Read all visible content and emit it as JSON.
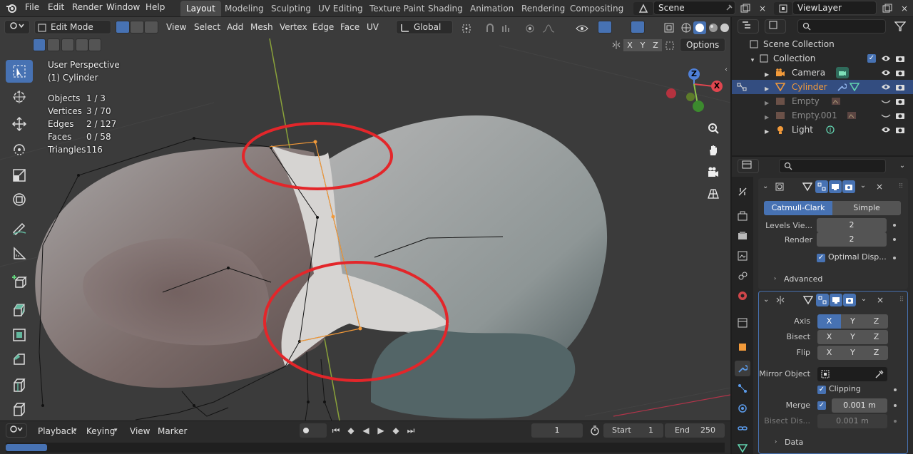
{
  "topbar": {
    "menus": [
      "File",
      "Edit",
      "Render",
      "Window",
      "Help"
    ],
    "workspaces": [
      "Layout",
      "Modeling",
      "Sculpting",
      "UV Editing",
      "Texture Paint",
      "Shading",
      "Animation",
      "Rendering",
      "Compositing"
    ],
    "active_workspace": "Layout",
    "scene": "Scene",
    "view_layer": "ViewLayer"
  },
  "viewport_header": {
    "mode": "Edit Mode",
    "menus": [
      "View",
      "Select",
      "Add",
      "Mesh",
      "Vertex",
      "Edge",
      "Face",
      "UV"
    ],
    "transform_orientation": "Global",
    "options_label": "Options",
    "axis_toggles": [
      "X",
      "Y",
      "Z"
    ]
  },
  "overlay": {
    "view_name": "User Perspective",
    "object_name": "(1) Cylinder",
    "stats": [
      {
        "label": "Objects",
        "value": "1 / 3"
      },
      {
        "label": "Vertices",
        "value": "3 / 70"
      },
      {
        "label": "Edges",
        "value": "2 / 127"
      },
      {
        "label": "Faces",
        "value": "0 / 58"
      },
      {
        "label": "Triangles",
        "value": "116"
      }
    ]
  },
  "gizmo": {
    "x": "X",
    "y": "Y",
    "z": "Z"
  },
  "timeline": {
    "menus": [
      "Playback",
      "Keying",
      "View",
      "Marker"
    ],
    "current_frame": "1",
    "start_label": "Start",
    "start": "1",
    "end_label": "End",
    "end": "250"
  },
  "outliner": {
    "root": "Scene Collection",
    "collection": "Collection",
    "items": [
      {
        "name": "Camera",
        "selected": false,
        "dim": false
      },
      {
        "name": "Cylinder",
        "selected": true,
        "dim": false
      },
      {
        "name": "Empty",
        "selected": false,
        "dim": true
      },
      {
        "name": "Empty.001",
        "selected": false,
        "dim": true
      },
      {
        "name": "Light",
        "selected": false,
        "dim": false
      }
    ]
  },
  "subsurf": {
    "tabs": [
      "Catmull-Clark",
      "Simple"
    ],
    "active_tab": "Catmull-Clark",
    "levels_label": "Levels Vie...",
    "levels_value": "2",
    "render_label": "Render",
    "render_value": "2",
    "optimal_label": "Optimal Disp...",
    "advanced_label": "Advanced"
  },
  "mirror": {
    "axis_label": "Axis",
    "bisect_label": "Bisect",
    "flip_label": "Flip",
    "axes": [
      "X",
      "Y",
      "Z"
    ],
    "mirror_object_label": "Mirror Object",
    "clipping_label": "Clipping",
    "merge_label": "Merge",
    "merge_value": "0.001 m",
    "bisect_distance_label": "Bisect Dis...",
    "bisect_distance_value": "0.001 m",
    "data_label": "Data"
  },
  "colors": {
    "accent": "#4772b3",
    "annotation": "#e3262a",
    "selected_row": "#334d80",
    "object_orange": "#f29a3a"
  }
}
